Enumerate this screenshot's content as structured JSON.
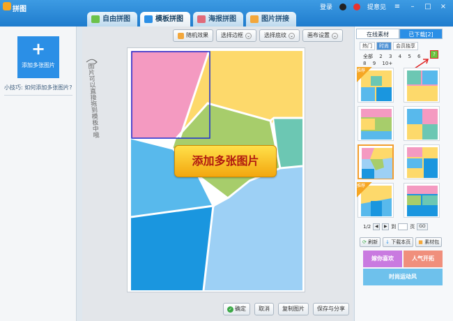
{
  "window": {
    "app_title": "拼图"
  },
  "top_right": {
    "login": "登录",
    "feedback": "提意见"
  },
  "tabs": [
    {
      "label": "自由拼图"
    },
    {
      "label": "模板拼图"
    },
    {
      "label": "海报拼图"
    },
    {
      "label": "图片拼接"
    }
  ],
  "left": {
    "add_label": "添加多张图片",
    "tip": "小技巧: 如何添加多张图片?"
  },
  "toolbar": {
    "random_effect": "随机效果",
    "select_border": "选择边框",
    "select_pattern": "选择底纹",
    "canvas_settings": "画布设置"
  },
  "canvas": {
    "hand_note": "图片可以直接拖到模板中哦",
    "add_multi": "添加多张图片"
  },
  "bottom": {
    "confirm": "确定",
    "cancel": "取消",
    "copy_image": "复制图片",
    "save_share": "保存与分享"
  },
  "right": {
    "tab_online": "在线素材",
    "tab_downloaded": "已下载[2]",
    "subtabs": [
      "热门",
      "时尚",
      "会员独享"
    ],
    "counts_row1": [
      "全部",
      "2",
      "3",
      "4",
      "5",
      "6"
    ],
    "counts_row2": [
      "8",
      "9",
      "10+"
    ],
    "help": "?",
    "ribbon_label": "推荐",
    "page": "1/2",
    "goto_label": "到",
    "page_unit": "页",
    "go_label": "GO",
    "refresh": "刷新",
    "download_page": "下载本页",
    "material_pack": "素材包",
    "banner_cute": "嫁你喜欢",
    "banner_popular": "人气开拓",
    "banner_sport": "时尚运动风"
  },
  "colors": {
    "pink": "#f49ac1",
    "yellow": "#fdd96b",
    "green": "#a7cd6b",
    "teal": "#6cc7b3",
    "sky": "#58b9ec",
    "blue": "#1a96df",
    "lightblue": "#9dd0f5",
    "accent": "#2b8fe6"
  }
}
